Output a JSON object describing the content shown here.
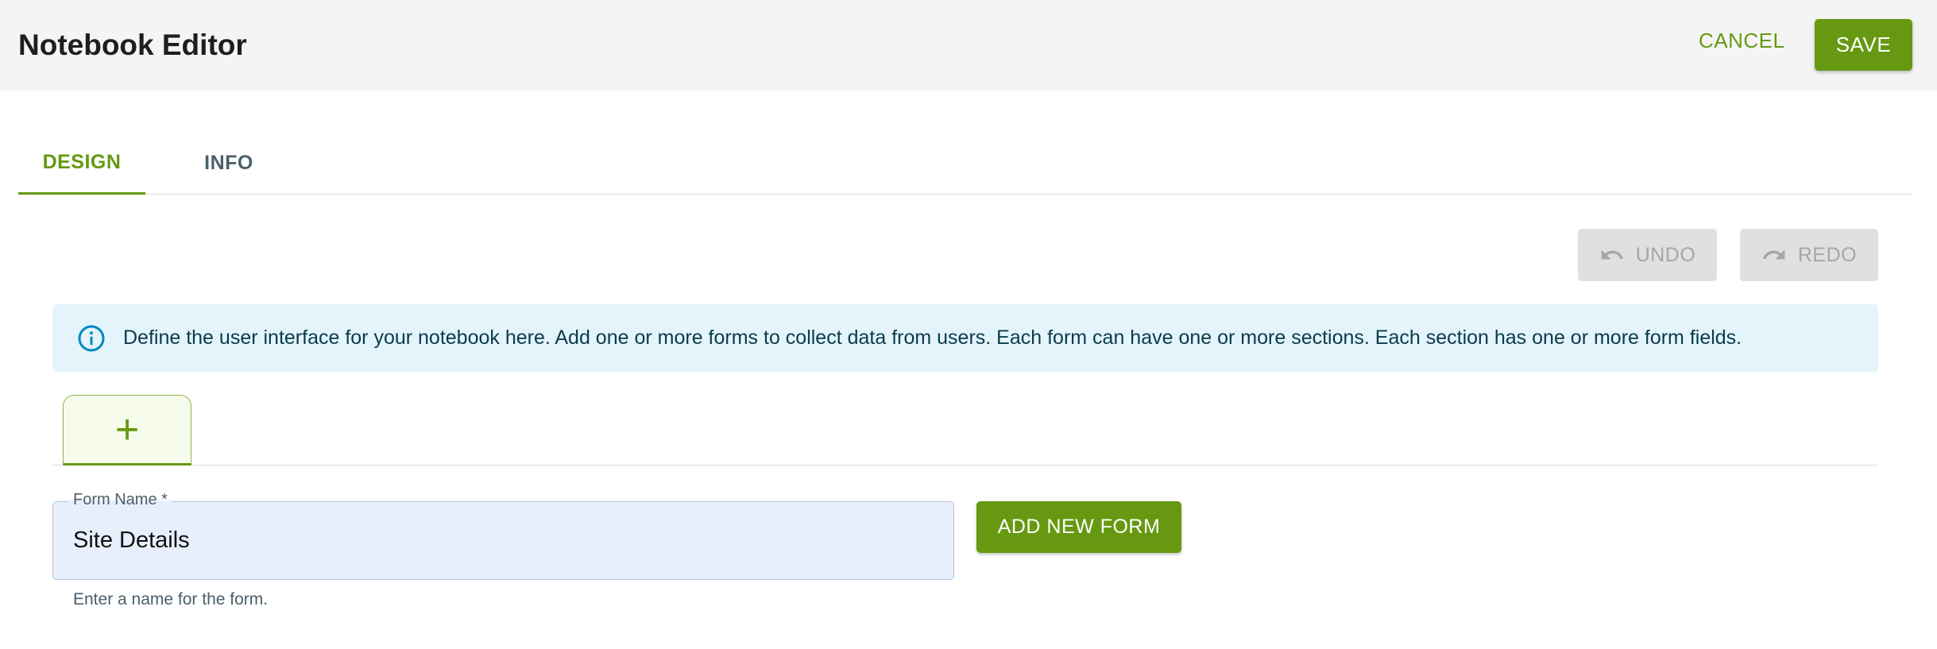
{
  "header": {
    "title": "Notebook Editor",
    "cancel_label": "CANCEL",
    "save_label": "SAVE"
  },
  "tabs": [
    {
      "label": "DESIGN",
      "active": true
    },
    {
      "label": "INFO",
      "active": false
    }
  ],
  "toolbar": {
    "undo_label": "UNDO",
    "redo_label": "REDO",
    "undo_icon": "undo-icon",
    "redo_icon": "redo-icon"
  },
  "info_alert": {
    "icon": "info-icon",
    "text": "Define the user interface for your notebook here. Add one or more forms to collect data from users. Each form can have one or more sections. Each section has one or more form fields."
  },
  "form_tabs": {
    "add_tab_label": "+"
  },
  "form_name": {
    "label": "Form Name *",
    "value": "Site Details",
    "helper": "Enter a name for the form."
  },
  "add_form_button": "ADD NEW FORM",
  "colors": {
    "accent": "#669911",
    "topbar_bg": "#f4f4f4",
    "info_bg": "#e3f4fa",
    "disabled_bg": "#e0e0e0"
  }
}
